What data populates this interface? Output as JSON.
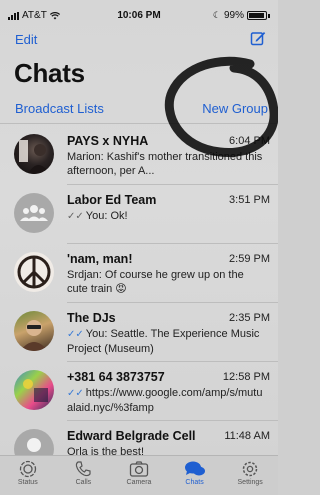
{
  "status_bar": {
    "carrier": "AT&T",
    "time": "10:06 PM",
    "battery": "99%"
  },
  "header": {
    "edit_label": "Edit",
    "compose_icon": "compose-icon",
    "title": "Chats"
  },
  "links": {
    "broadcast_lists": "Broadcast Lists",
    "new_group": "New Group"
  },
  "chats": [
    {
      "name": "PAYS x NYHA",
      "time": "6:04 PM",
      "preview": "Marion: Kashif's mother transitioned this afternoon, per A...",
      "avatar": "photo-dark"
    },
    {
      "name": "Labor Ed Team",
      "time": "3:51 PM",
      "ticks": "✓✓",
      "ticks_read": false,
      "preview": "You: Ok!",
      "avatar": "group-placeholder"
    },
    {
      "name": "'nam, man!",
      "time": "2:59 PM",
      "preview": "Srdjan: Of course he grew up on the cute train 😡",
      "avatar": "peace-sign"
    },
    {
      "name": "The DJs",
      "time": "2:35 PM",
      "ticks": "✓✓",
      "ticks_read": true,
      "preview": "You: Seattle. The Experience Music Project (Museum)",
      "avatar": "photo-person"
    },
    {
      "name": "+381 64 3873757",
      "time": "12:58 PM",
      "ticks": "✓✓",
      "ticks_read": true,
      "preview": "https://www.google.com/amp/s/mutualaid.nyc/%3famp",
      "avatar": "photo-colorful"
    },
    {
      "name": "Edward Belgrade Cell",
      "time": "11:48 AM",
      "preview": "Orla is the best!",
      "avatar": "person-placeholder"
    }
  ],
  "tabs": [
    {
      "label": "Status",
      "icon": "status-icon"
    },
    {
      "label": "Calls",
      "icon": "phone-icon"
    },
    {
      "label": "Camera",
      "icon": "camera-icon"
    },
    {
      "label": "Chats",
      "icon": "chats-icon",
      "active": true
    },
    {
      "label": "Settings",
      "icon": "gear-icon"
    }
  ],
  "colors": {
    "accent": "#1f5fd1",
    "read_ticks": "#3a7bd5"
  }
}
